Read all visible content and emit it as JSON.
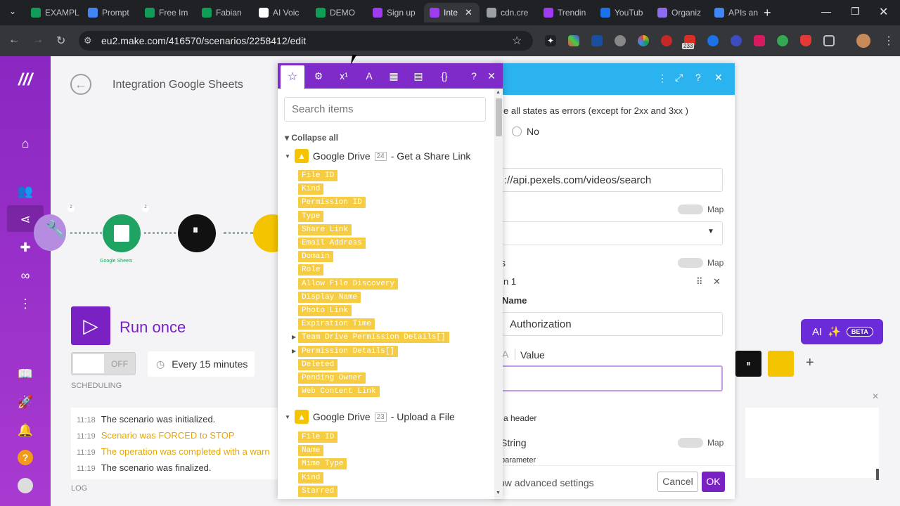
{
  "browser": {
    "tabs": [
      {
        "label": "EXAMPL",
        "color": "#0f9d58"
      },
      {
        "label": "Prompt",
        "color": "#4285f4"
      },
      {
        "label": "Free Im",
        "color": "#0f9d58"
      },
      {
        "label": "Fabian",
        "color": "#0f9d58"
      },
      {
        "label": "AI Voic",
        "color": "#ffffff"
      },
      {
        "label": "DEMO",
        "color": "#0f9d58"
      },
      {
        "label": "Sign up",
        "color": "#a03cf0"
      },
      {
        "label": "Inte",
        "color": "#a03cf0"
      },
      {
        "label": "cdn.cre",
        "color": "#9aa0a6"
      },
      {
        "label": "Trendin",
        "color": "#a03cf0"
      },
      {
        "label": "YouTub",
        "color": "#1a73e8"
      },
      {
        "label": "Organiz",
        "color": "#8e6cef"
      },
      {
        "label": "APIs an",
        "color": "#4285f4"
      }
    ],
    "url": "eu2.make.com/416570/scenarios/2258412/edit",
    "ext_badge": "233"
  },
  "scenario": {
    "title": "Integration Google Sheets",
    "node_label": "Google Sheets",
    "node_counts": [
      "2",
      "2"
    ],
    "run_once": "Run once",
    "toggle": "OFF",
    "schedule": "Every 15 minutes",
    "scheduling_label": "SCHEDULING",
    "log_label": "LOG",
    "log": [
      {
        "time": "11:18",
        "text": "The scenario was initialized.",
        "color": "#333333"
      },
      {
        "time": "11:19",
        "text": "Scenario was FORCED to STOP",
        "color": "#e6a700"
      },
      {
        "time": "11:19",
        "text": "The operation was completed with a warn",
        "color": "#e6a700"
      },
      {
        "time": "11:19",
        "text": "The scenario was finalized.",
        "color": "#333333"
      }
    ]
  },
  "picker": {
    "search_placeholder": "Search items",
    "collapse_all": "Collapse all",
    "groups": [
      {
        "app": "Google Drive",
        "num": "24",
        "action": "- Get a Share Link"
      },
      {
        "app": "Google Drive",
        "num": "23",
        "action": "- Upload a File"
      }
    ],
    "items1": [
      "File ID",
      "Kind",
      "Permission ID",
      "Type",
      "Share Link",
      "Email Address",
      "Domain",
      "Role",
      "Allow File Discovery",
      "Display Name",
      "Photo Link",
      "Expiration Time",
      "Team Drive Permission Details[]",
      "Permission Details[]",
      "Deleted",
      "Pending Owner",
      "Web Content Link"
    ],
    "items2": [
      "File ID",
      "Name",
      "Mime Type",
      "Kind",
      "Starred"
    ]
  },
  "dialog": {
    "errors_text": "e all states as errors (except for 2xx and 3xx )",
    "no_label": "No",
    "url_value": "://api.pexels.com/videos/search",
    "map": "Map",
    "item_label": "n 1",
    "name_label": "Name",
    "name_value": "Authorization",
    "value_label": "Value",
    "header_note": "a header",
    "string_label": "String",
    "param_note": "parameter",
    "advanced": "ow advanced settings",
    "cancel": "Cancel",
    "ok": "OK"
  },
  "ai": {
    "label": "AI",
    "beta": "BETA"
  }
}
